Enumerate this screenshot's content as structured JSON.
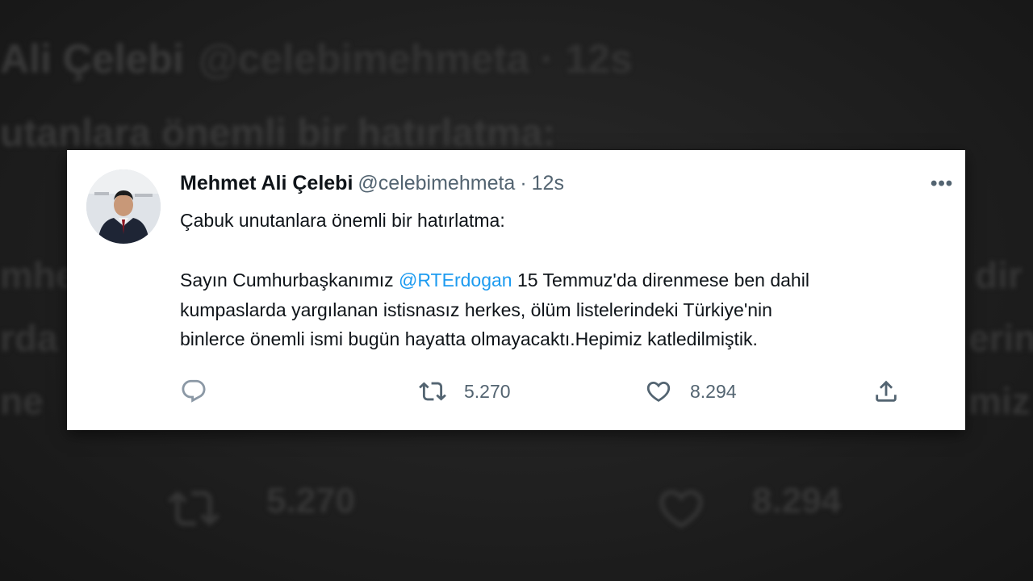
{
  "background": {
    "name_line": "Ali Çelebi",
    "handle_line": "@celebimehmeta · 12s",
    "text_line": "utanlara önemli bir hatırlatma:",
    "fragments": [
      "mhe",
      "rda",
      "ne",
      "dir",
      "erin",
      "miz"
    ],
    "retweet_count": "5.270",
    "like_count": "8.294"
  },
  "tweet": {
    "author_name": "Mehmet Ali Çelebi",
    "author_handle": "@celebimehmeta",
    "separator": "·",
    "time": "12s",
    "more_label": "•••",
    "line1": "Çabuk unutanlara önemli bir hatırlatma:",
    "line2_pre": "Sayın Cumhurbaşkanımız ",
    "mention": "@RTErdogan",
    "line2_post": " 15 Temmuz'da direnmese ben dahil",
    "line3": "kumpaslarda yargılanan istisnasız herkes, ölüm listelerindeki Türkiye'nin",
    "line4": "binlerce önemli ismi bugün hayatta olmayacaktı.Hepimiz katledilmiştik.",
    "actions": {
      "reply_icon": "reply-icon",
      "retweet_icon": "retweet-icon",
      "retweet_count": "5.270",
      "like_icon": "heart-icon",
      "like_count": "8.294",
      "share_icon": "share-icon"
    }
  },
  "colors": {
    "mention": "#1d9bf0",
    "secondary_text": "#536471",
    "primary_text": "#0f1419",
    "backdrop": "#1e1e1e"
  }
}
